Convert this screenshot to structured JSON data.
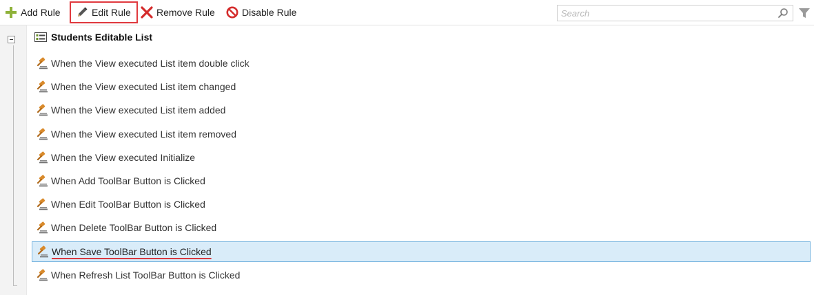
{
  "toolbar": {
    "add_label": "Add Rule",
    "edit_label": "Edit Rule",
    "remove_label": "Remove Rule",
    "disable_label": "Disable Rule",
    "search_placeholder": "Search"
  },
  "colors": {
    "add_icon": "#8fb23a",
    "remove_icon": "#d42b2b",
    "disable_icon": "#d42b2b",
    "highlight_border": "#e0393e",
    "selected_row_bg": "#d9ecf9",
    "selected_row_border": "#7ab6e0",
    "rule_icon": "#d98a2b"
  },
  "tree": {
    "title": "Students Editable List",
    "rules": [
      {
        "label": "When the View executed List item double click"
      },
      {
        "label": "When the View executed List item changed"
      },
      {
        "label": "When the View executed List item added"
      },
      {
        "label": "When the View executed List item removed"
      },
      {
        "label": "When the View executed Initialize"
      },
      {
        "label": "When Add ToolBar Button is Clicked"
      },
      {
        "label": "When Edit ToolBar Button is Clicked"
      },
      {
        "label": "When Delete ToolBar Button is Clicked"
      },
      {
        "label": "When Save ToolBar Button is Clicked",
        "selected": true
      },
      {
        "label": "When Refresh List ToolBar Button is Clicked"
      }
    ]
  },
  "icons": {
    "add": "plus-icon",
    "edit": "pencil-icon",
    "remove": "x-icon",
    "disable": "no-entry-icon",
    "search": "search-icon",
    "filter": "funnel-icon",
    "list": "list-view-icon",
    "rule": "gavel-icon"
  }
}
